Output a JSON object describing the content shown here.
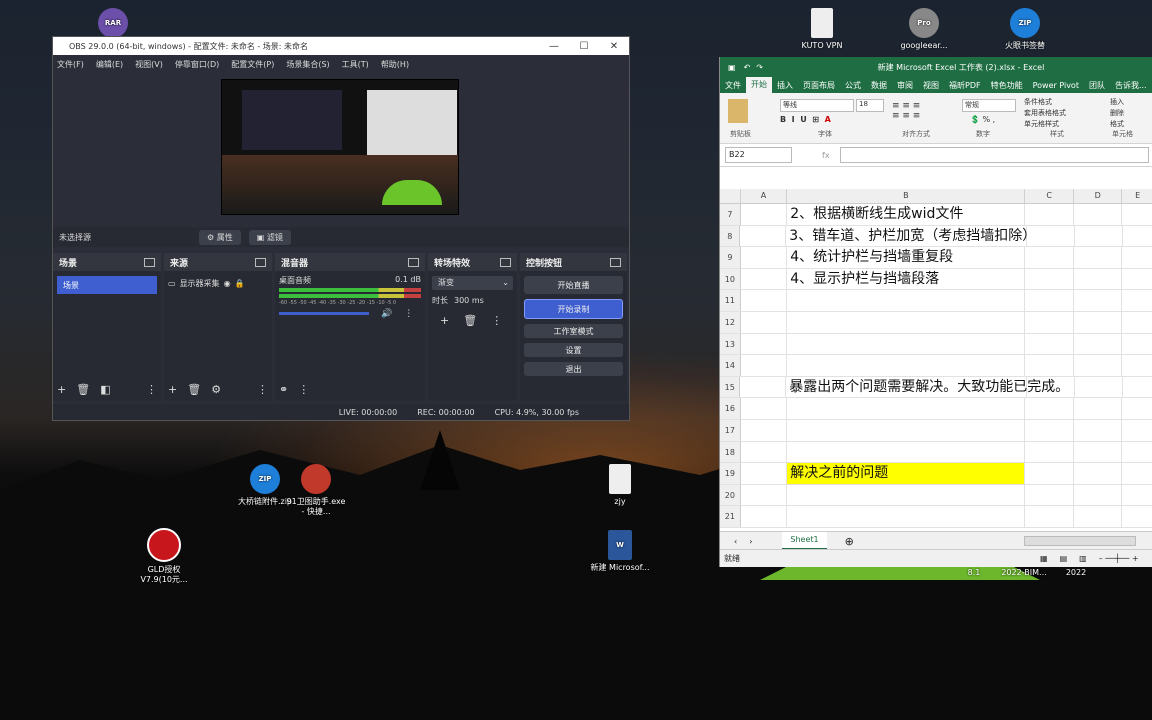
{
  "desktop": {
    "icons": [
      {
        "label": "",
        "badge": "RAR"
      },
      {
        "label": "KUTO VPN",
        "badge": ""
      },
      {
        "label": "googleear...",
        "badge": "Pro"
      },
      {
        "label": "火眼书签替",
        "badge": "ZIP"
      },
      {
        "label": "大桥链附件.zip",
        "badge": "ZIP"
      },
      {
        "label": "91卫图助手.exe - 快捷...",
        "badge": ""
      },
      {
        "label": "zjy",
        "badge": ""
      },
      {
        "label": "GLD授权 V7.9(10元...",
        "badge": ""
      },
      {
        "label": "新建 Microsof...",
        "badge": "W"
      }
    ],
    "partial_labels": [
      "8.1",
      "2022-BIM...",
      "2022"
    ]
  },
  "obs": {
    "title": "OBS 29.0.0 (64-bit, windows) - 配置文件: 未命名 - 场景: 未命名",
    "menu": [
      "文件(F)",
      "编辑(E)",
      "视图(V)",
      "停靠窗口(D)",
      "配置文件(P)",
      "场景集合(S)",
      "工具(T)",
      "帮助(H)"
    ],
    "no_source": "未选择源",
    "properties_btn": "属性",
    "filters_btn": "滤镜",
    "scenes": {
      "title": "场景",
      "items": [
        "场景"
      ]
    },
    "sources": {
      "title": "来源",
      "items": [
        "显示器采集"
      ]
    },
    "mixer": {
      "title": "混音器",
      "channel": "桌面音频",
      "db": "0.1 dB",
      "scale": "-60 -55 -50 -45 -40 -35 -30 -25 -20 -15 -10 -5 0"
    },
    "transitions": {
      "title": "转场特效",
      "selected": "渐变",
      "duration_label": "时长",
      "duration": "300 ms"
    },
    "controls": {
      "title": "控制按钮",
      "stream": "开始直播",
      "record": "开始录制",
      "studio": "工作室模式",
      "settings": "设置",
      "exit": "退出"
    },
    "status": {
      "live": "LIVE: 00:00:00",
      "rec": "REC: 00:00:00",
      "cpu": "CPU: 4.9%, 30.00 fps"
    }
  },
  "excel": {
    "title": "新建 Microsoft Excel 工作表 (2).xlsx - Excel",
    "tabs": [
      "文件",
      "开始",
      "插入",
      "页面布局",
      "公式",
      "数据",
      "审阅",
      "视图",
      "福昕PDF",
      "特色功能",
      "Power Pivot",
      "团队",
      "告诉我..."
    ],
    "active_tab": "开始",
    "font": "等线",
    "size": "18",
    "number_format": "常规",
    "groups": [
      "剪贴板",
      "字体",
      "对齐方式",
      "数字",
      "样式",
      "单元格"
    ],
    "style_items": [
      "条件格式",
      "套用表格格式",
      "单元格样式"
    ],
    "cell_items": [
      "插入",
      "删除",
      "格式"
    ],
    "name_box": "B22",
    "columns": [
      "A",
      "B",
      "C",
      "D",
      "E"
    ],
    "rows": [
      {
        "n": "7",
        "b": "2、根据横断线生成wid文件",
        "hl": false
      },
      {
        "n": "8",
        "b": "3、错车道、护栏加宽（考虑挡墙扣除）",
        "hl": false
      },
      {
        "n": "9",
        "b": "4、统计护栏与挡墙重复段",
        "hl": false
      },
      {
        "n": "10",
        "b": "4、显示护栏与挡墙段落",
        "hl": false
      },
      {
        "n": "11",
        "b": "",
        "hl": false
      },
      {
        "n": "12",
        "b": "",
        "hl": false
      },
      {
        "n": "13",
        "b": "",
        "hl": false
      },
      {
        "n": "14",
        "b": "",
        "hl": false
      },
      {
        "n": "15",
        "b": "暴露出两个问题需要解决。大致功能已完成。",
        "hl": false
      },
      {
        "n": "16",
        "b": "",
        "hl": false
      },
      {
        "n": "17",
        "b": "",
        "hl": false
      },
      {
        "n": "18",
        "b": "",
        "hl": false
      },
      {
        "n": "19",
        "b": "解决之前的问题",
        "hl": true
      },
      {
        "n": "20",
        "b": "",
        "hl": false
      },
      {
        "n": "21",
        "b": "",
        "hl": false
      }
    ],
    "sheet_tab": "Sheet1",
    "status": "就绪"
  }
}
